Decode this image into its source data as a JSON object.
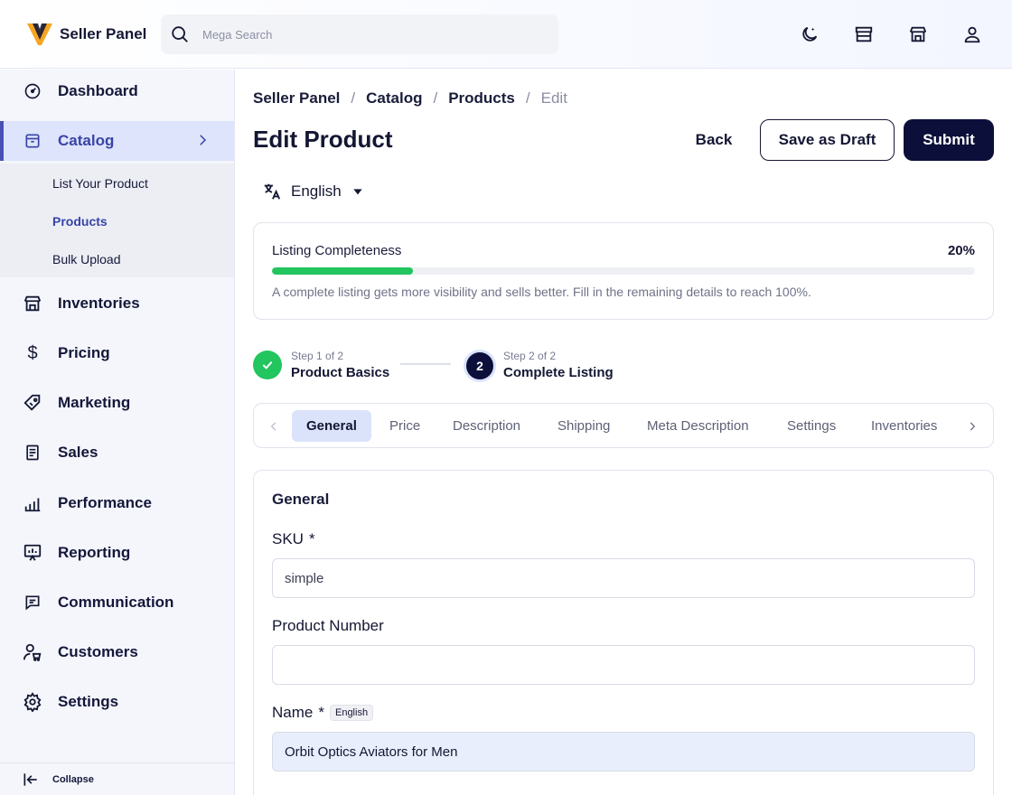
{
  "brand": {
    "name": "Seller Panel"
  },
  "search": {
    "placeholder": "Mega Search"
  },
  "header_icons": [
    "moon-icon",
    "store-icon",
    "shop-icon",
    "user-icon"
  ],
  "sidebar": {
    "items": [
      {
        "label": "Dashboard",
        "icon": "dashboard-icon"
      },
      {
        "label": "Catalog",
        "icon": "catalog-icon"
      },
      {
        "label": "Inventories",
        "icon": "inventory-icon"
      },
      {
        "label": "Pricing",
        "icon": "dollar-icon"
      },
      {
        "label": "Marketing",
        "icon": "tag-icon"
      },
      {
        "label": "Sales",
        "icon": "receipt-icon"
      },
      {
        "label": "Performance",
        "icon": "bar-chart-icon"
      },
      {
        "label": "Reporting",
        "icon": "presentation-icon"
      },
      {
        "label": "Communication",
        "icon": "message-icon"
      },
      {
        "label": "Customers",
        "icon": "customers-icon"
      },
      {
        "label": "Settings",
        "icon": "gear-icon"
      }
    ],
    "catalog_sub": [
      "List Your Product",
      "Products",
      "Bulk Upload"
    ],
    "collapse_label": "Collapse"
  },
  "breadcrumb": [
    "Seller Panel",
    "Catalog",
    "Products",
    "Edit"
  ],
  "page_title": "Edit Product",
  "actions": {
    "back": "Back",
    "draft": "Save as Draft",
    "submit": "Submit"
  },
  "language": {
    "selected": "English"
  },
  "completeness": {
    "title": "Listing Completeness",
    "percent_label": "20%",
    "percent": 20,
    "description": "A complete listing gets more visibility and sells better. Fill in the remaining details to reach 100%.",
    "bar_color": "#22c55e"
  },
  "steps": [
    {
      "small": "Step 1 of 2",
      "title": "Product Basics",
      "status": "done"
    },
    {
      "small": "Step 2 of 2",
      "title": "Complete Listing",
      "status": "current",
      "number": "2"
    }
  ],
  "tabs": [
    "General",
    "Price",
    "Description",
    "Shipping",
    "Meta Description",
    "Settings",
    "Inventories"
  ],
  "active_tab": "General",
  "form": {
    "section_title": "General",
    "sku": {
      "label": "SKU",
      "required": "*",
      "value": "simple"
    },
    "product_number": {
      "label": "Product Number",
      "value": ""
    },
    "name": {
      "label": "Name",
      "required": "*",
      "badge": "English",
      "value": "Orbit Optics Aviators for Men"
    }
  },
  "colors": {
    "accent": "#3944a6",
    "primary_dark": "#0c0f3a",
    "success": "#22c55e"
  }
}
